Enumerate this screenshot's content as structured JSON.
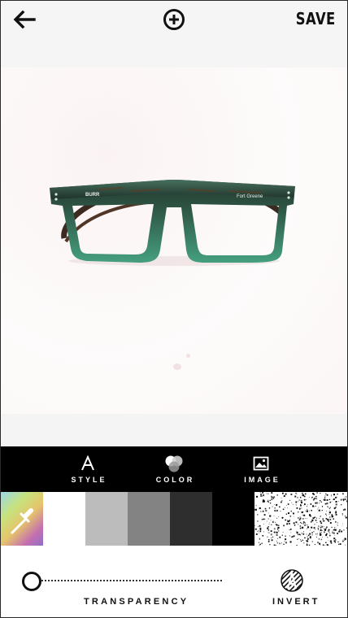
{
  "header": {
    "back_icon": "arrow-left-icon",
    "add_icon": "circle-plus-icon",
    "save_label": "SAVE"
  },
  "photo": {
    "subject": "green eyeglasses",
    "frame_colors": {
      "top": "#2c4a3c",
      "bottom": "#3f9277",
      "temple": "#3a2a20"
    },
    "brand_texts": [
      "BURR",
      "Fort Greene"
    ]
  },
  "tools": [
    {
      "label": "STYLE",
      "icon": "text-style-icon"
    },
    {
      "label": "COLOR",
      "icon": "color-circles-icon"
    },
    {
      "label": "IMAGE",
      "icon": "image-icon"
    }
  ],
  "swatches": [
    {
      "name": "gradient-eyedropper",
      "icon": "eyedropper-icon"
    },
    {
      "name": "white",
      "color": "#ffffff",
      "selected": true
    },
    {
      "name": "light-gray",
      "color": "#bcbcbc"
    },
    {
      "name": "gray",
      "color": "#838383"
    },
    {
      "name": "dark-gray",
      "color": "#2e2e2e"
    },
    {
      "name": "black",
      "color": "#000000"
    },
    {
      "name": "texture",
      "pattern": "speckled-noise"
    }
  ],
  "controls": {
    "transparency_label": "TRANSPARENCY",
    "transparency_value": 0,
    "invert_label": "INVERT",
    "invert_icon": "invert-hatch-icon"
  }
}
